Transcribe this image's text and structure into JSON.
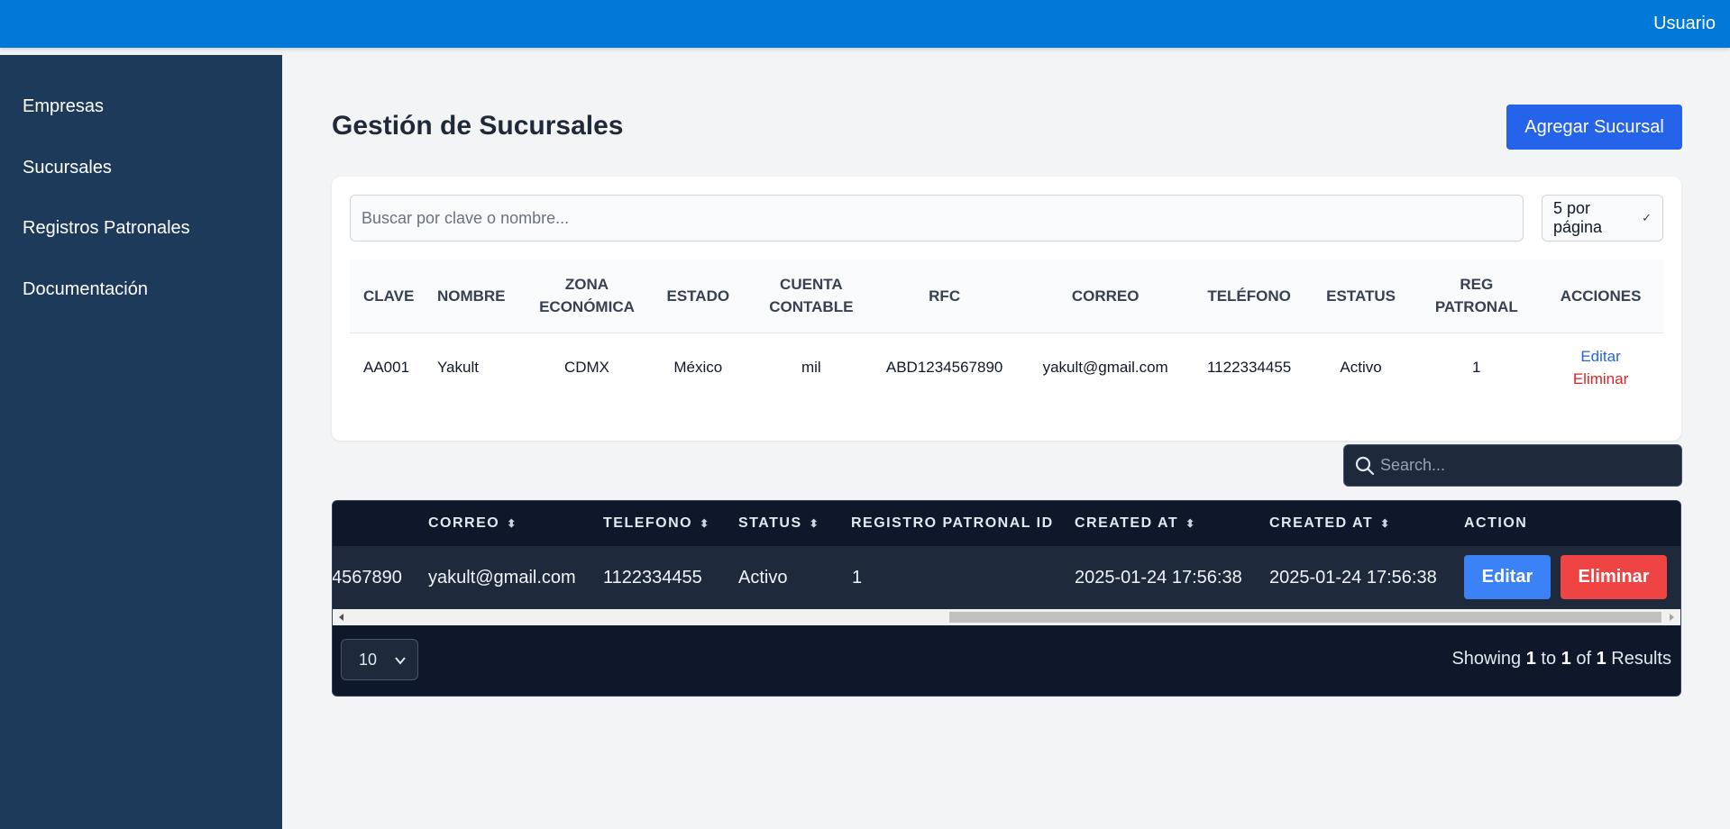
{
  "topbar": {
    "user": "Usuario"
  },
  "sidebar": {
    "items": [
      {
        "label": "Empresas"
      },
      {
        "label": "Sucursales"
      },
      {
        "label": "Registros Patronales"
      },
      {
        "label": "Documentación"
      }
    ]
  },
  "page": {
    "title": "Gestión de Sucursales",
    "add_button": "Agregar Sucursal"
  },
  "filters": {
    "search_placeholder": "Buscar por clave o nombre...",
    "per_page": "5 por página"
  },
  "table": {
    "headers": [
      "CLAVE",
      "NOMBRE",
      "ZONA ECONÓMICA",
      "ESTADO",
      "CUENTA CONTABLE",
      "RFC",
      "CORREO",
      "TELÉFONO",
      "ESTATUS",
      "REG PATRONAL",
      "ACCIONES"
    ],
    "rows": [
      {
        "clave": "AA001",
        "nombre": "Yakult",
        "zona": "CDMX",
        "estado": "México",
        "cuenta": "mil",
        "rfc": "ABD1234567890",
        "correo": "yakult@gmail.com",
        "telefono": "1122334455",
        "estatus": "Activo",
        "reg_patronal": "1",
        "edit": "Editar",
        "delete": "Eliminar"
      }
    ]
  },
  "datatable": {
    "search_placeholder": "Search...",
    "headers": [
      "CORREO",
      "TELEFONO",
      "STATUS",
      "REGISTRO PATRONAL ID",
      "CREATED AT",
      "CREATED AT",
      "ACTION"
    ],
    "row": {
      "rfc_partial": "4567890",
      "correo": "yakult@gmail.com",
      "telefono": "1122334455",
      "status": "Activo",
      "registro": "1",
      "created_1": "2025-01-24 17:56:38",
      "created_2": "2025-01-24 17:56:38"
    },
    "edit_button": "Editar",
    "delete_button": "Eliminar",
    "page_size": "10",
    "showing": {
      "prefix": "Showing",
      "from": "1",
      "to_word": "to",
      "to": "1",
      "of_word": "of",
      "total": "1",
      "suffix": "Results"
    }
  },
  "colors": {
    "topbar": "#0078d7",
    "sidebar": "#1e3a5a",
    "primary": "#2563eb",
    "danger": "#ef4444",
    "dark_table": "#0f172a"
  },
  "icons": {
    "search": "search-icon",
    "sort": "sort-icon",
    "chevron": "chevron-down-icon"
  }
}
